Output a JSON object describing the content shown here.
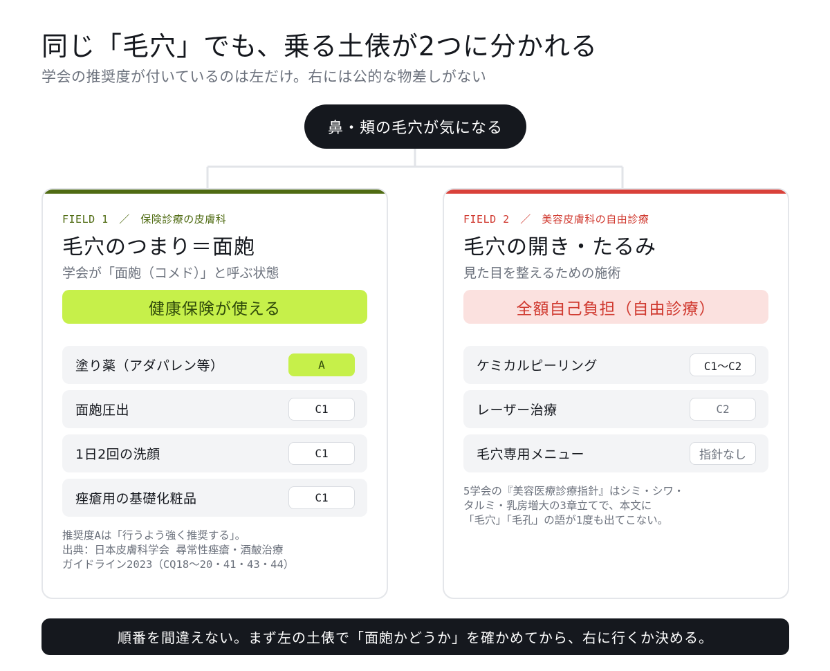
{
  "header": {
    "title": "同じ「毛穴」でも、乗る土俵が2つに分かれる",
    "subtitle": "学会の推奨度が付いているのは左だけ。右には公的な物差しがない"
  },
  "root": {
    "label": "鼻・頬の毛穴が気になる"
  },
  "colors": {
    "left_accent": "#4f6b12",
    "left_highlight": "#c6f04a",
    "right_accent": "#d9413a",
    "right_highlight": "#fbe1df",
    "dark": "#15181e"
  },
  "left": {
    "field": "FIELD 1　／　保険診療の皮膚科",
    "title": "毛穴のつまり＝面皰",
    "desc": "学会が「面皰（コメド）」と呼ぶ状態",
    "banner": "健康保険が使える",
    "rows": [
      {
        "label": "塗り薬（アダパレン等）",
        "badge": "A"
      },
      {
        "label": "面皰圧出",
        "badge": "C1"
      },
      {
        "label": "1日2回の洗顔",
        "badge": "C1"
      },
      {
        "label": "痤瘡用の基礎化粧品",
        "badge": "C1"
      }
    ],
    "note": {
      "line1": "推奨度Aは「行うよう強く推奨する」。",
      "line2": "出典：日本皮膚科学会 尋常性痤瘡・酒皶治療",
      "line3": "ガイドライン2023（CQ18〜20・41・43・44）"
    }
  },
  "right": {
    "field": "FIELD 2　／　美容皮膚科の自由診療",
    "title": "毛穴の開き・たるみ",
    "desc": "見た目を整えるための施術",
    "banner": "全額自己負担（自由診療）",
    "rows": [
      {
        "label": "ケミカルピーリング",
        "badge": "C1〜C2"
      },
      {
        "label": "レーザー治療",
        "badge": "C2"
      },
      {
        "label": "毛穴専用メニュー",
        "badge": "指針なし"
      }
    ],
    "note": {
      "line1": "5学会の『美容医療診療指針』はシミ・シワ・",
      "line2": "タルミ・乳房増大の3章立てで、本文に",
      "line3": "「毛穴」「毛孔」の語が1度も出てこない。"
    }
  },
  "footer": {
    "text": "順番を間違えない。まず左の土俵で「面皰かどうか」を確かめてから、右に行くか決める。"
  }
}
